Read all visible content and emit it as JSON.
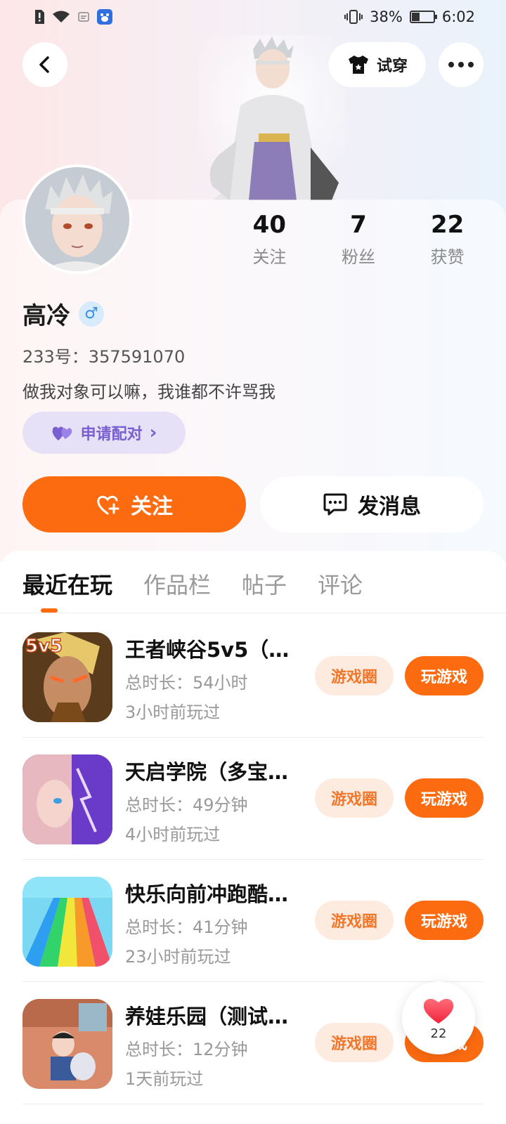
{
  "status_bar": {
    "battery_percent": "38%",
    "time": "6:02",
    "battery_level": 0.38
  },
  "header": {
    "tryon_label": "试穿"
  },
  "profile": {
    "stats": [
      {
        "num": "40",
        "label": "关注"
      },
      {
        "num": "7",
        "label": "粉丝"
      },
      {
        "num": "22",
        "label": "获赞"
      }
    ],
    "name": "高冷",
    "gender_symbol": "♂",
    "uid": "233号：357591070",
    "bio": "做我对象可以嘛，我谁都不许骂我",
    "pair_label": "申请配对",
    "pair_chevron": "›",
    "follow_label": "关注",
    "message_label": "发消息"
  },
  "tabs": [
    "最近在玩",
    "作品栏",
    "帖子",
    "评论"
  ],
  "games": [
    {
      "title": "王者峡谷5v5（…",
      "duration": "总时长：54小时",
      "last_played": "3小时前玩过",
      "circle_label": "游戏圈",
      "play_label": "玩游戏",
      "badge": "5v5"
    },
    {
      "title": "天启学院（多宝…",
      "duration": "总时长：49分钟",
      "last_played": "4小时前玩过",
      "circle_label": "游戏圈",
      "play_label": "玩游戏"
    },
    {
      "title": "快乐向前冲跑酷…",
      "duration": "总时长：41分钟",
      "last_played": "23小时前玩过",
      "circle_label": "游戏圈",
      "play_label": "玩游戏"
    },
    {
      "title": "养娃乐园（测试…",
      "duration": "总时长：12分钟",
      "last_played": "1天前玩过",
      "circle_label": "游戏圈",
      "play_label": "玩游戏"
    }
  ],
  "like_fab": {
    "count": "22"
  },
  "colors": {
    "accent": "#fd6b10",
    "pair_purple": "#7a5fd1",
    "male_blue": "#3b8ee8"
  }
}
